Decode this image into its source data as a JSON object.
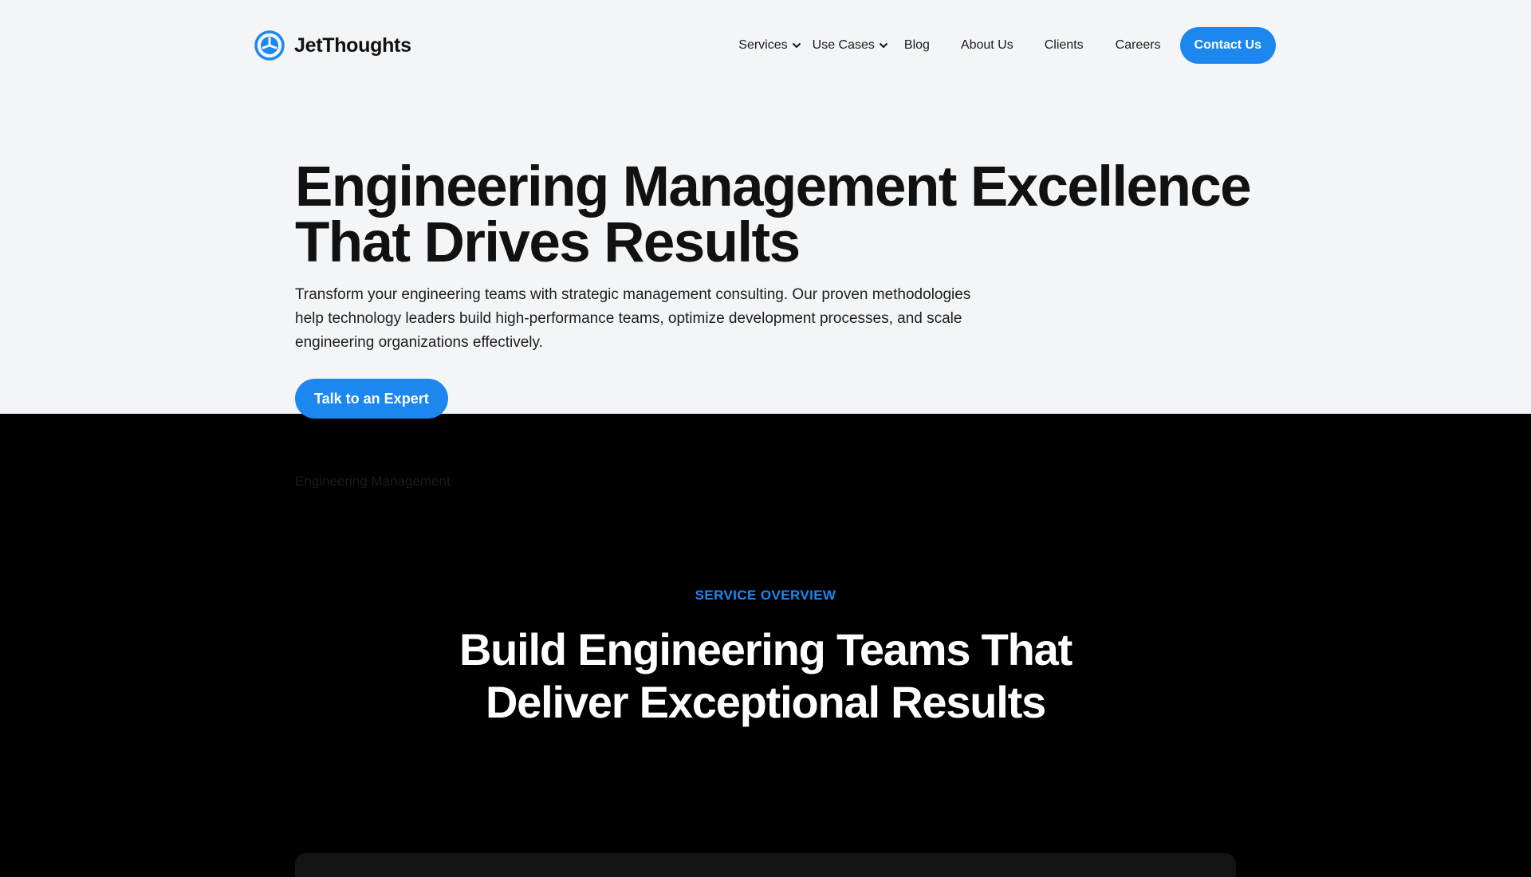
{
  "brand": {
    "name": "JetThoughts",
    "accent": "#1d87f0"
  },
  "nav": {
    "items": [
      {
        "label": "Services",
        "dropdown": true
      },
      {
        "label": "Use Cases",
        "dropdown": true
      },
      {
        "label": "Blog"
      },
      {
        "label": "About Us"
      },
      {
        "label": "Clients"
      },
      {
        "label": "Careers"
      }
    ],
    "cta": "Contact Us"
  },
  "hero": {
    "title": "Engineering Management Excellence That Drives Results",
    "description": "Transform your engineering teams with strategic management consulting. Our proven methodologies help technology leaders build high-performance teams, optimize development processes, and scale engineering organizations effectively.",
    "cta": "Talk to an Expert"
  },
  "breadcrumb": "Engineering Management",
  "overview": {
    "eyebrow": "SERVICE OVERVIEW",
    "title": "Build Engineering Teams That Deliver Exceptional Results"
  }
}
